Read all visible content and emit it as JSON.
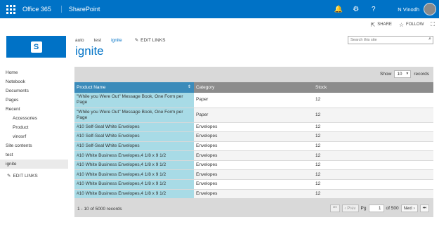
{
  "suite": {
    "brand": "Office 365",
    "app": "SharePoint",
    "user": "N Vinodh",
    "icons": [
      "bell-icon",
      "gear-icon",
      "help-icon"
    ],
    "bell_glyph": "🔔",
    "gear_glyph": "⚙",
    "help_glyph": "?",
    "color": "#0072c6"
  },
  "actions": {
    "share": "SHARE",
    "follow": "FOLLOW"
  },
  "topnav": {
    "items": [
      "auto",
      "test",
      "ignite"
    ],
    "edit_links": "EDIT LINKS"
  },
  "page": {
    "title": "ignite"
  },
  "search": {
    "placeholder": "Search this site"
  },
  "leftnav": {
    "items": [
      {
        "label": "Home"
      },
      {
        "label": "Notebook"
      },
      {
        "label": "Documents"
      },
      {
        "label": "Pages"
      },
      {
        "label": "Recent"
      },
      {
        "label": "Accessories"
      },
      {
        "label": "Product"
      },
      {
        "label": "vinosrf"
      },
      {
        "label": "Site contents"
      },
      {
        "label": "test"
      },
      {
        "label": "ignite"
      }
    ],
    "edit_links": "EDIT LINKS"
  },
  "grid": {
    "show_label": "Show",
    "show_value": "10",
    "records_label": "records",
    "columns": [
      "Product Name",
      "Category",
      "Stock"
    ],
    "rows": [
      [
        "\"While you Were Out\" Message Book, One Form per Page",
        "Paper",
        "12"
      ],
      [
        "\"While you Were Out\" Message Book, One Form per Page",
        "Paper",
        "12"
      ],
      [
        "#10 Self-Seal White Envelopes",
        "Envelopes",
        "12"
      ],
      [
        "#10 Self-Seal White Envelopes",
        "Envelopes",
        "12"
      ],
      [
        "#10 Self-Seal White Envelopes",
        "Envelopes",
        "12"
      ],
      [
        "#10 White Business Envelopes,4 1/8 x 9 1/2",
        "Envelopes",
        "12"
      ],
      [
        "#10 White Business Envelopes,4 1/8 x 9 1/2",
        "Envelopes",
        "12"
      ],
      [
        "#10 White Business Envelopes,4 1/8 x 9 1/2",
        "Envelopes",
        "12"
      ],
      [
        "#10 White Business Envelopes,4 1/8 x 9 1/2",
        "Envelopes",
        "12"
      ],
      [
        "#10 White Business Envelopes,4 1/8 x 9 1/2",
        "Envelopes",
        "12"
      ]
    ],
    "footer_text": "1 - 10 of 5000 records",
    "pager": {
      "prev": "Prev",
      "pg_label": "Pg",
      "page": "1",
      "of_label": "of 500",
      "next": "Next"
    }
  }
}
